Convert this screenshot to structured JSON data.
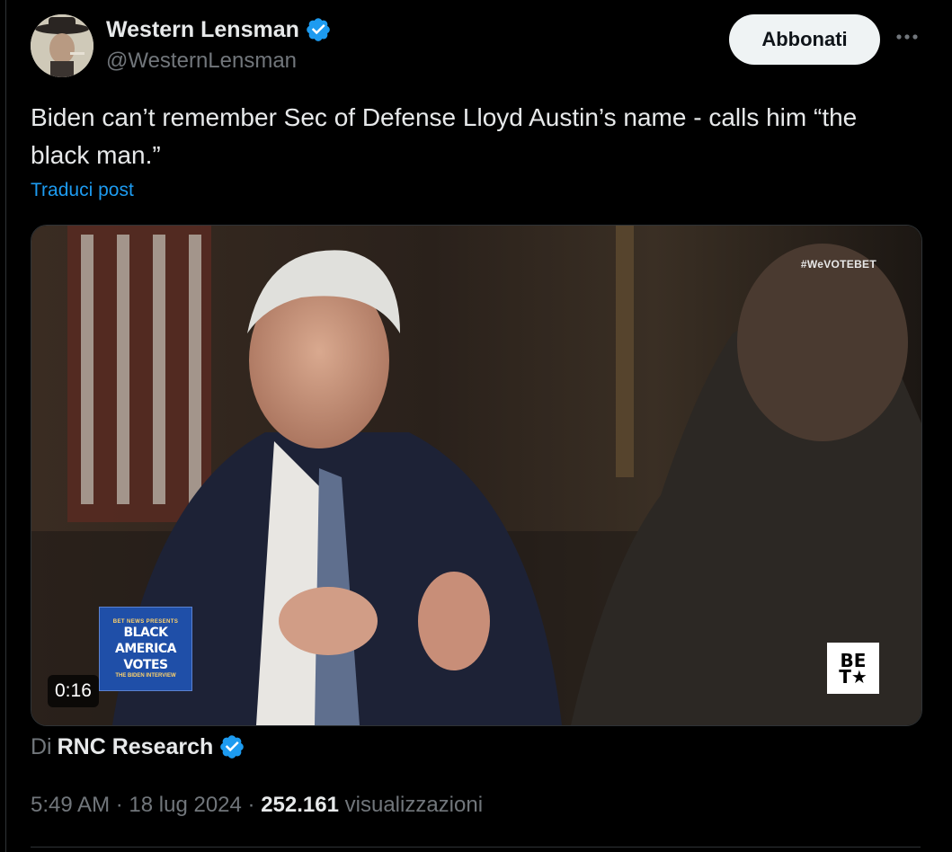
{
  "author": {
    "name": "Western Lensman",
    "handle": "@WesternLensman",
    "verified": true
  },
  "header": {
    "subscribe_label": "Abbonati",
    "more_icon": "more-horizontal-icon"
  },
  "post": {
    "text": "Biden can’t remember Sec of Defense Lloyd Austin’s name - calls him “the black man.”",
    "translate_label": "Traduci post"
  },
  "media": {
    "hashtag": "#WeVOTEBET",
    "duration": "0:16",
    "badge": {
      "top": "BET NEWS PRESENTS",
      "title_line1": "BLACK",
      "title_line2": "AMERICA",
      "title_line3": "VOTES",
      "subtitle": "THE BIDEN INTERVIEW"
    },
    "logo": {
      "line1": "BE",
      "line2": "T★"
    }
  },
  "source": {
    "prefix": "Di",
    "name": "RNC Research",
    "verified": true
  },
  "meta": {
    "time": "5:49 AM",
    "separator": "·",
    "date": "18 lug 2024",
    "views_count": "252.161",
    "views_label": "visualizzazioni"
  },
  "colors": {
    "background": "#000000",
    "text": "#e7e9ea",
    "muted": "#71767b",
    "link": "#1d9bf0",
    "verified_badge": "#1d9bf0"
  }
}
